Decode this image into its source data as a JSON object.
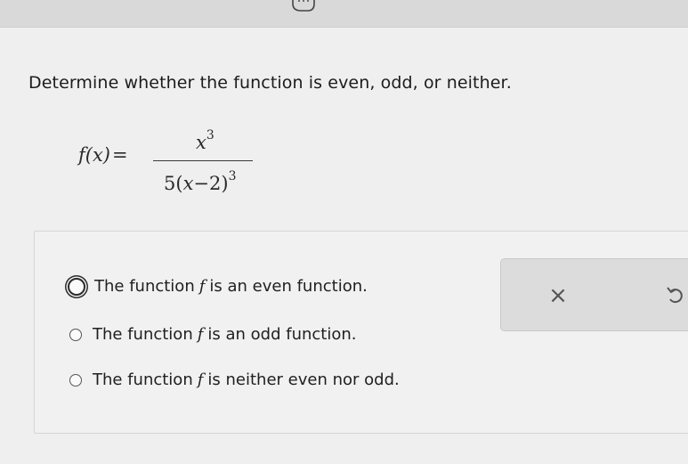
{
  "question": {
    "text": "Determine whether the function is even, odd, or neither."
  },
  "formula": {
    "lhs": "f(x)",
    "equals": "=",
    "numerator_base": "x",
    "numerator_exp": "3",
    "denominator_coef": "5",
    "denominator_open": "(",
    "denominator_var": "x",
    "denominator_op": "−2",
    "denominator_close": ")",
    "denominator_exp": "3"
  },
  "options": [
    {
      "prefix": "The function",
      "var": "f",
      "suffix": "is an even function.",
      "selected": true
    },
    {
      "prefix": "The function",
      "var": "f",
      "suffix": "is an odd function.",
      "selected": false
    },
    {
      "prefix": "The function",
      "var": "f",
      "suffix": "is neither even nor odd.",
      "selected": false
    }
  ],
  "actions": {
    "clear_label": "×",
    "clear_icon": "close-icon",
    "undo_icon": "undo-icon"
  },
  "colors": {
    "background": "#efefef",
    "panel": "#f1f1f1",
    "action_box": "#dcdcdc",
    "text": "#1f1f1f"
  }
}
